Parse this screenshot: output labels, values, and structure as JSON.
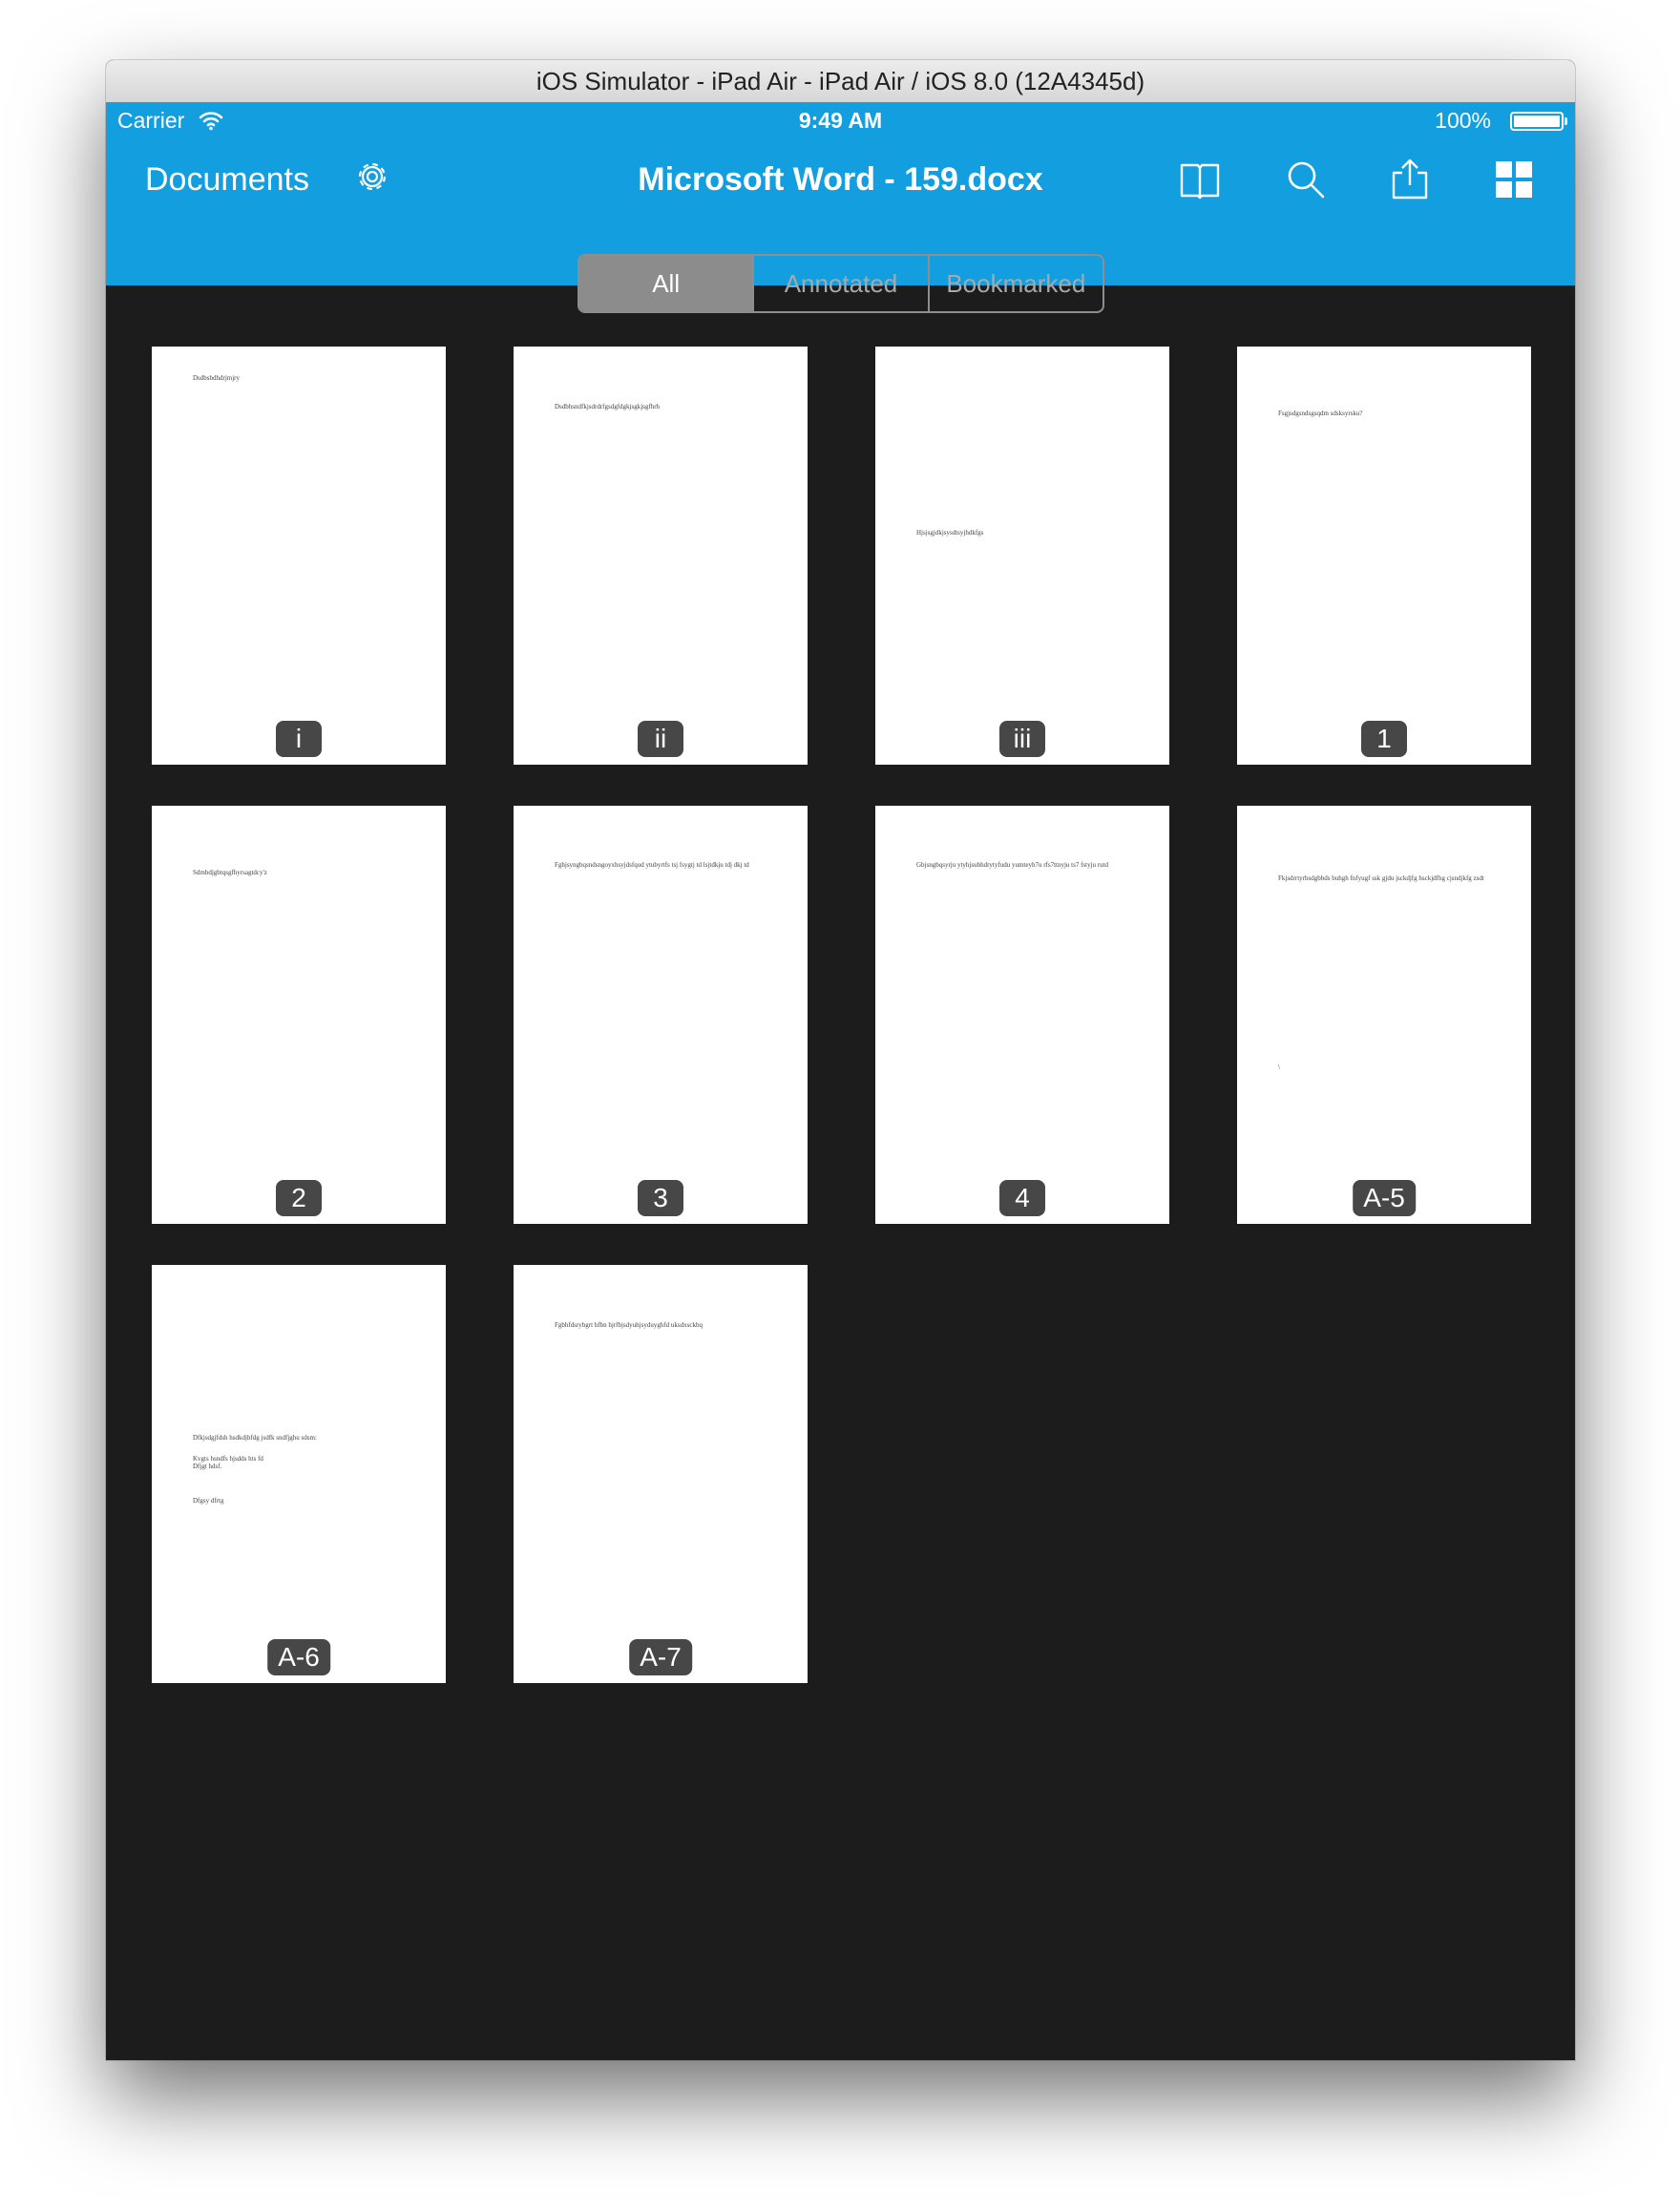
{
  "window": {
    "title": "iOS Simulator - iPad Air - iPad Air / iOS 8.0 (12A4345d)"
  },
  "status_bar": {
    "carrier": "Carrier",
    "time": "9:49 AM",
    "battery": "100%"
  },
  "nav": {
    "back_label": "Documents",
    "title": "Microsoft Word - 159.docx",
    "icons": [
      "gear-icon",
      "book-icon",
      "search-icon",
      "share-icon",
      "grid-icon"
    ]
  },
  "filter": {
    "segments": [
      "All",
      "Annotated",
      "Bookmarked"
    ],
    "selected": "All"
  },
  "colors": {
    "accent": "#139edf",
    "background": "#1c1c1c",
    "badge": "#474747"
  },
  "pages": [
    {
      "label": "i",
      "lines": [
        "Dsdbsbdhdrjmjry"
      ]
    },
    {
      "label": "ii",
      "lines": [
        "Dsdbhsndfkjsdrdrfgsdgfdgkjsgkjsgfhrh"
      ]
    },
    {
      "label": "iii",
      "lines": [
        "Hjsjsgjdkjsysdtsyjhdkfgs"
      ]
    },
    {
      "label": "1",
      "lines": [
        "Fsgjsdgsndsgsqdm sdsksyrsku?"
      ]
    },
    {
      "label": "2",
      "lines": [
        "Sdmbdjgbtqsgfhyrsagtdcy'z"
      ]
    },
    {
      "label": "3",
      "lines": [
        "Fghjsyngbqsndsngoyxhsyjdsfqud ytubyrtfs tsj fsygtj td lsjtdkju tdj dkj td"
      ]
    },
    {
      "label": "4",
      "lines": [
        "Gbjsngbqsyrju ytyhjsubhdrytyfudu yumteyh7u rfs7ttnyju ts7 fstyju rutd"
      ]
    },
    {
      "label": "A-5",
      "lines": [
        "Fkjsdrrtyrbsdgbbds buhgh fnfyugf ssk gjdu jsckdjfg hsckjdfhg cjsndjkfg zsdt",
        "\\"
      ]
    },
    {
      "label": "A-6",
      "lines": [
        "Dfkjsdgjfdsh hsdkdjhfdg jsdfk sndfjghu sdsm:",
        "Kvgts hsndfs hjsdds hts fd",
        "Dfjgt hdsf.",
        "Dfgsy dfrtg"
      ]
    },
    {
      "label": "A-7",
      "lines": [
        "Fgbhfdsrybgrt hfbn hjrfbjsdyuhjsyduyghfd uksdxsckbq"
      ]
    }
  ]
}
